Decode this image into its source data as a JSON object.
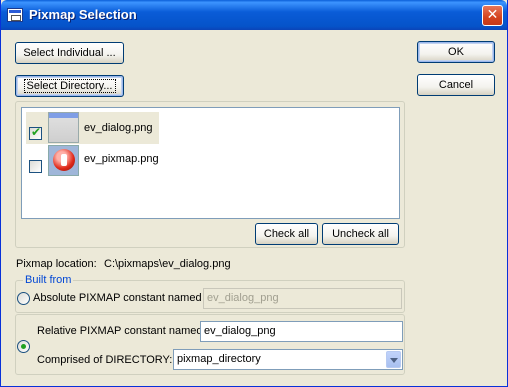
{
  "window": {
    "title": "Pixmap Selection",
    "close_icon": "close-icon"
  },
  "buttons": {
    "select_individual": "Select Individual ...",
    "select_directory": "Select Directory...",
    "ok": "OK",
    "cancel": "Cancel",
    "check_all": "Check all",
    "uncheck_all": "Uncheck all"
  },
  "pixmap_list": [
    {
      "name": "ev_dialog.png",
      "checked": true,
      "icon": "dialog-thumbnail-icon"
    },
    {
      "name": "ev_pixmap.png",
      "checked": false,
      "icon": "pixmap-thumbnail-icon"
    }
  ],
  "location": {
    "label": "Pixmap location:",
    "value": "C:\\pixmaps\\ev_dialog.png"
  },
  "built_from": {
    "legend": "Built from",
    "absolute": {
      "label": "Absolute PIXMAP constant named",
      "value": "ev_dialog_png",
      "selected": false
    },
    "relative": {
      "label": "Relative PIXMAP constant named:",
      "value": "ev_dialog_png",
      "selected": true
    },
    "directory": {
      "label": "Comprised of DIRECTORY:",
      "value": "pixmap_directory"
    }
  },
  "colors": {
    "titlebar": "#0553c9",
    "face": "#ece9d8",
    "close": "#d4431e",
    "accent": "#21a121"
  }
}
